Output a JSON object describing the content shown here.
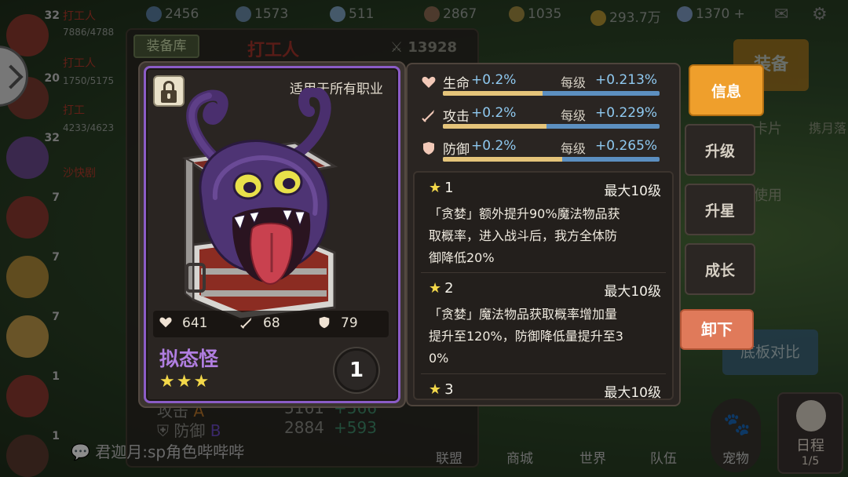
{
  "resources": [
    {
      "value": "2456",
      "icon": "gem-icon"
    },
    {
      "value": "1573",
      "icon": "crystal-icon"
    },
    {
      "value": "511",
      "icon": "scroll-icon"
    },
    {
      "value": "2867",
      "icon": "ore-icon"
    },
    {
      "value": "1035",
      "icon": "wheat-icon"
    },
    {
      "value": "293.7万",
      "icon": "gold-coin-icon"
    },
    {
      "value": "1370",
      "icon": "diamond-icon"
    }
  ],
  "heroes": [
    {
      "level": "32",
      "hp": "7886/4788",
      "tag": "打工人"
    },
    {
      "level": "20",
      "hp": "1750/5175",
      "tag": "打工人"
    },
    {
      "level": "",
      "hp": "4233/4623",
      "tag": "打工"
    },
    {
      "level": "32",
      "hp": "",
      "tag": "沙快剧"
    },
    {
      "level": "7",
      "hp": "",
      "tag": ""
    },
    {
      "level": "7",
      "hp": "",
      "tag": ""
    },
    {
      "level": "7",
      "hp": "",
      "tag": ""
    },
    {
      "level": "1",
      "hp": "",
      "tag": ""
    },
    {
      "level": "1",
      "hp": "",
      "tag": ""
    }
  ],
  "equip_panel": {
    "tab": "装备库",
    "worker_name": "打工人",
    "power": "13928",
    "stats_behind": [
      {
        "label": "攻击",
        "grade": "A",
        "value": "5161",
        "plus": "+566"
      },
      {
        "label": "防御",
        "grade": "B",
        "value": "2884",
        "plus": "+593"
      }
    ],
    "chat": "君迦月:sp角色哔哔哔",
    "bottom_tabs": [
      "联盟",
      "商城",
      "世界",
      "队伍"
    ]
  },
  "side": {
    "equip_label": "装备",
    "compare_label": "底板对比",
    "pet_label": "宠物",
    "schedule_label": "日程",
    "schedule_count": "1/5",
    "card_hint": "卡片",
    "use_hint": "使用",
    "event_hint": "携月落"
  },
  "item": {
    "job_text": "适用于所有职业",
    "name": "拟态怪",
    "stars": "★★★",
    "count": "1",
    "stats": {
      "hp": "641",
      "atk": "68",
      "def": "79"
    },
    "name_color": "#b07ee0",
    "frame_color": "#8b5cc7"
  },
  "bonuses": [
    {
      "name": "生命",
      "pct": "+0.2%",
      "per_label": "每级",
      "per_value": "+0.213%",
      "progress": 0.46,
      "icon": "heart-icon"
    },
    {
      "name": "攻击",
      "pct": "+0.2%",
      "per_label": "每级",
      "per_value": "+0.229%",
      "progress": 0.48,
      "icon": "sword-icon"
    },
    {
      "name": "防御",
      "pct": "+0.2%",
      "per_label": "每级",
      "per_value": "+0.265%",
      "progress": 0.55,
      "icon": "shield-icon"
    }
  ],
  "skills": [
    {
      "level": "1",
      "max": "最大10级",
      "lines": [
        "「贪婪」额外提升90%魔法物品获",
        "取概率，进入战斗后，我方全体防",
        "御降低20%"
      ]
    },
    {
      "level": "2",
      "max": "最大10级",
      "lines": [
        "「贪婪」魔法物品获取概率增加量",
        "提升至120%，防御降低量提升至3",
        "0%"
      ]
    },
    {
      "level": "3",
      "max": "最大10级",
      "lines": []
    }
  ],
  "tabs": {
    "info": "信息",
    "upgrade": "升级",
    "star_up": "升星",
    "growth": "成长",
    "unequip": "卸下"
  },
  "colors": {
    "accent": "#ef9f2c",
    "unequip": "#e07a5a",
    "bonus_text": "#8fc9f0",
    "star": "#f3d84a"
  }
}
